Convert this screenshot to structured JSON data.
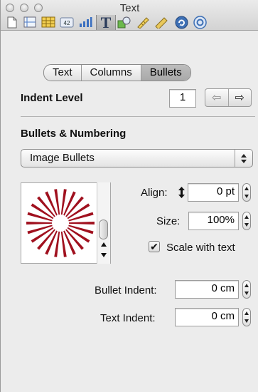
{
  "window": {
    "title": "Text"
  },
  "toolbar": {
    "items": [
      {
        "name": "document-inspector-icon"
      },
      {
        "name": "layout-inspector-icon"
      },
      {
        "name": "table-inspector-icon"
      },
      {
        "name": "format-inspector-icon",
        "badge": "42"
      },
      {
        "name": "chart-inspector-icon"
      },
      {
        "name": "text-inspector-icon",
        "glyph": "T"
      },
      {
        "name": "graphic-inspector-icon"
      },
      {
        "name": "metrics-inspector-icon"
      },
      {
        "name": "link-inspector-icon"
      },
      {
        "name": "quicktime-inspector-icon"
      }
    ]
  },
  "tabs": [
    {
      "label": "Text",
      "selected": false
    },
    {
      "label": "Columns",
      "selected": false
    },
    {
      "label": "Bullets",
      "selected": true
    }
  ],
  "indent_level": {
    "label": "Indent Level",
    "value": "1"
  },
  "bullets_numbering": {
    "label": "Bullets & Numbering",
    "selected": "Image Bullets"
  },
  "align": {
    "label": "Align:",
    "value": "0 pt"
  },
  "size": {
    "label": "Size:",
    "value": "100%"
  },
  "scale_with_text": {
    "label": "Scale with text",
    "checked": true
  },
  "bullet_indent": {
    "label": "Bullet Indent:",
    "value": "0 cm"
  },
  "text_indent": {
    "label": "Text Indent:",
    "value": "0 cm"
  },
  "colors": {
    "bullet_image": "#a0101e",
    "accent": "#3d6fb4"
  }
}
